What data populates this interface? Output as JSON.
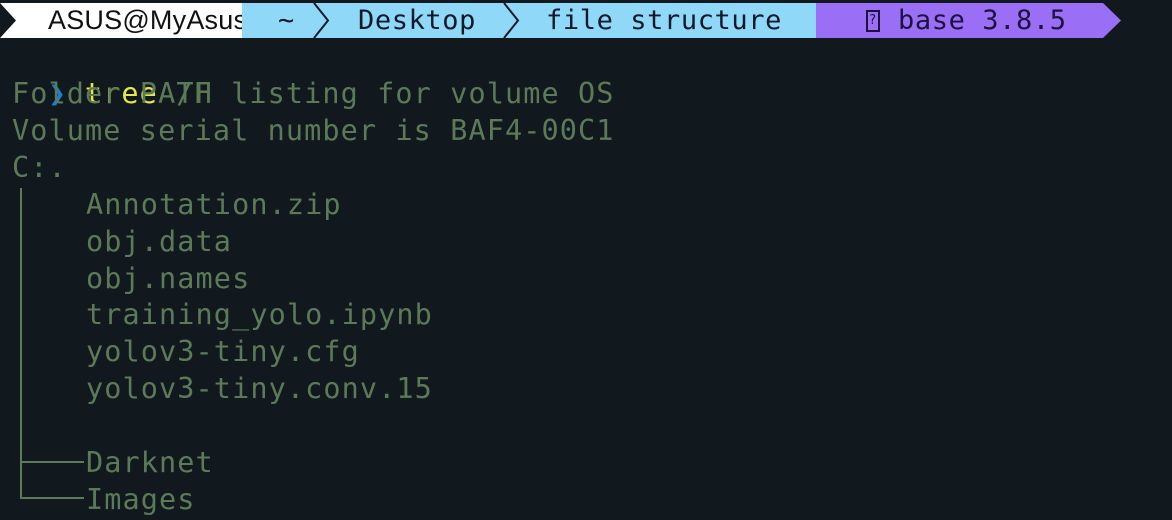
{
  "prompt": {
    "user_host": "ASUS@MyAsusPC",
    "path_segments": [
      "~",
      "Desktop",
      "file structure"
    ],
    "env_icon": "?",
    "env_label": "base 3.8.5",
    "colors": {
      "user_bg": "#ffffff",
      "path_bg": "#90d8f8",
      "env_bg": "#9a6ff5",
      "prompt_chevron": "#1a7fd0",
      "command": "#e4e84a",
      "output": "#5c7a58",
      "background": "#11191f"
    }
  },
  "command": {
    "chevron_icon": "❯",
    "name": "tree",
    "args": "/F"
  },
  "output": {
    "header_lines": [
      "Folder PATH listing for volume OS",
      "Volume serial number is BAF4-00C1",
      "C:."
    ],
    "files": [
      "Annotation.zip",
      "obj.data",
      "obj.names",
      "training_yolo.ipynb",
      "yolov3-tiny.cfg",
      "yolov3-tiny.conv.15"
    ],
    "folders": [
      "Darknet",
      "Images"
    ]
  }
}
